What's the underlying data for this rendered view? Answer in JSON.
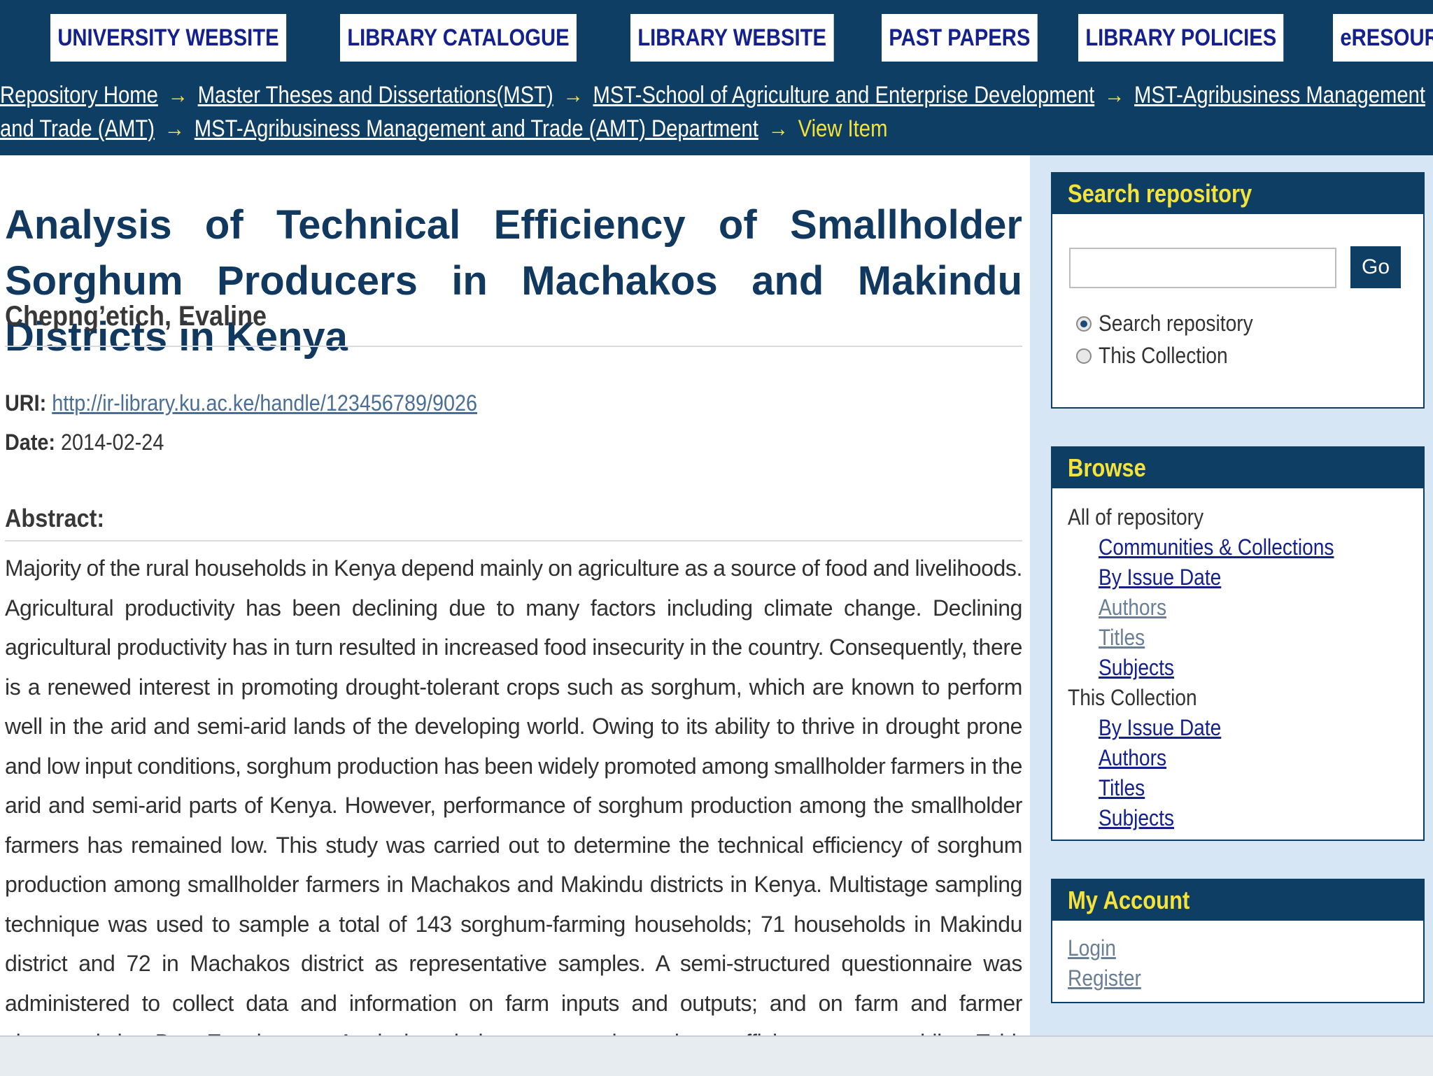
{
  "topnav": [
    "UNIVERSITY WEBSITE",
    "LIBRARY CATALOGUE",
    "LIBRARY WEBSITE",
    "PAST PAPERS",
    "LIBRARY POLICIES",
    "eRESOURCES"
  ],
  "breadcrumb": {
    "links": [
      "Repository Home",
      "Master Theses and Dissertations(MST)",
      "MST-School of Agriculture and Enterprise Development",
      "MST-Agribusiness Management and Trade (AMT)",
      "MST-Agribusiness Management and Trade (AMT) Department"
    ],
    "current": "View Item",
    "separator": "→"
  },
  "item": {
    "title": "Analysis of Technical Efficiency of Smallholder Sorghum Producers in Machakos and Makindu Districts in Kenya",
    "author": "Chepng’etich, Evaline",
    "uri_label": "URI:",
    "uri": "http://ir-library.ku.ac.ke/handle/123456789/9026",
    "date_label": "Date:",
    "date": "2014-02-24",
    "abstract_label": "Abstract:",
    "abstract": "Majority of the rural households in Kenya depend mainly on agriculture as a source of food and livelihoods. Agricultural productivity has been declining due to many factors including climate change. Declining agricultural productivity has in turn resulted in increased food insecurity in the country. Consequently, there is a renewed interest in promoting drought-tolerant crops such as sorghum, which are known to perform well in the arid and semi-arid lands of the developing world. Owing to its ability to thrive in drought prone and low input conditions, sorghum production has been widely promoted among smallholder farmers in the arid and semi-arid parts of Kenya. However, performance of sorghum production among the smallholder farmers has remained low. This study was carried out to determine the technical efficiency of sorghum production among smallholder farmers in Machakos and Makindu districts in Kenya. Multistage sampling technique was used to sample a total of 143 sorghum-farming households; 71 households in Makindu district and 72 in Machakos district as representative samples. A semi-structured questionnaire was administered to collect data and information on farm inputs and outputs; and on farm and farmer characteristics. Data Envelopment Analysis technique was used to estimate efficiency scores, while a Tobit regression analysis model"
  },
  "search": {
    "title": "Search repository",
    "input_value": "",
    "go_label": "Go",
    "options": [
      "Search repository",
      "This Collection"
    ],
    "selected": 0
  },
  "browse": {
    "title": "Browse",
    "all_label": "All of repository",
    "all_links": [
      "Communities & Collections",
      "By Issue Date",
      "Authors",
      "Titles",
      "Subjects"
    ],
    "collection_label": "This Collection",
    "collection_links": [
      "By Issue Date",
      "Authors",
      "Titles",
      "Subjects"
    ]
  },
  "account": {
    "title": "My Account",
    "links": [
      "Login",
      "Register"
    ]
  },
  "colors": {
    "header_bg": "#0e3e64",
    "accent_yellow": "#f5e33b",
    "nav_text": "#13208d",
    "page_bg": "#d6e6f5"
  }
}
